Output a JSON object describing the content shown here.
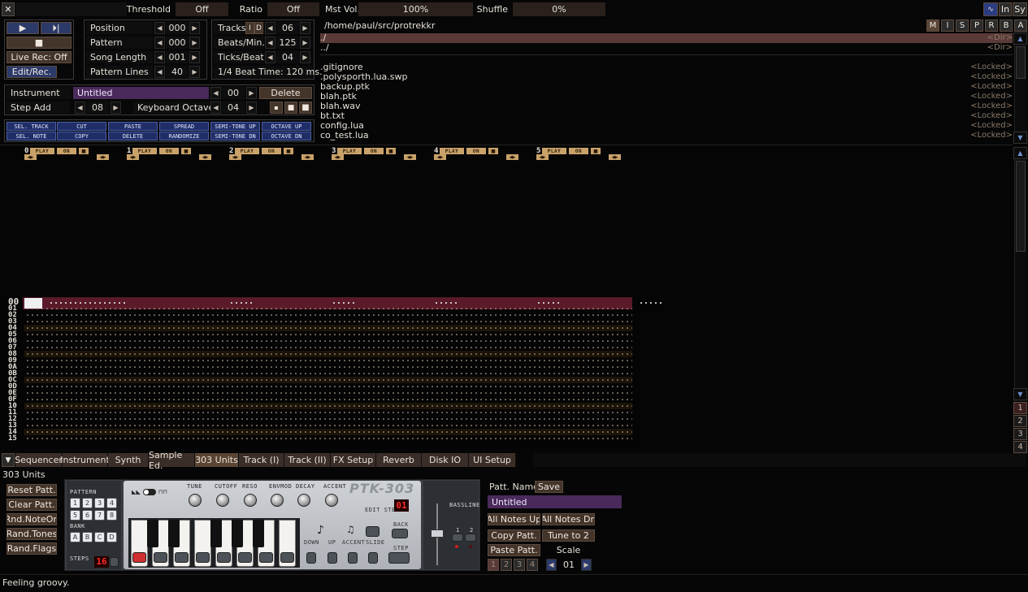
{
  "topbar": {
    "threshold_label": "Threshold",
    "threshold_value": "Off",
    "ratio_label": "Ratio",
    "ratio_value": "Off",
    "mst_vol_label": "Mst Vol.",
    "mst_vol_value": "100%",
    "shuffle_label": "Shuffle",
    "shuffle_value": "0%",
    "right_buttons": [
      "In",
      "Sy"
    ]
  },
  "transport": {
    "live_rec": "Live Rec: Off",
    "edit_rec": "Edit/Rec."
  },
  "song": {
    "position_label": "Position",
    "position_value": "000",
    "pattern_label": "Pattern",
    "pattern_value": "000",
    "song_length_label": "Song Length",
    "song_length_value": "001",
    "pattern_lines_label": "Pattern Lines",
    "pattern_lines_value": "40"
  },
  "tempo": {
    "tracks_label": "Tracks",
    "tracks_i": "I",
    "tracks_d": "D",
    "tracks_value": "06",
    "bpm_label": "Beats/Min.",
    "bpm_value": "125",
    "tpb_label": "Ticks/Beat",
    "tpb_value": "04",
    "beat_time": "1/4 Beat Time: 120 ms."
  },
  "instrument": {
    "label": "Instrument",
    "name": "Untitled",
    "number": "00",
    "delete": "Delete",
    "step_add_label": "Step Add",
    "step_add_value": "08",
    "kb_octave_label": "Keyboard Octave",
    "kb_octave_value": "04"
  },
  "fx_buttons": {
    "row1": [
      "SEL. TRACK",
      "CUT",
      "PASTE",
      "SPREAD",
      "SEMI-TONE UP",
      "OCTAVE UP"
    ],
    "row2": [
      "SEL. NOTE",
      "COPY",
      "DELETE",
      "RANDOMIZE",
      "SEMI-TONE DN",
      "OCTAVE DN"
    ]
  },
  "filebrowser": {
    "path": "/home/paul/src/protrekkr",
    "mode_buttons": [
      "M",
      "I",
      "S",
      "P",
      "R",
      "B",
      "A"
    ],
    "dirs": [
      {
        "name": "./",
        "tag": "<Dir>"
      },
      {
        "name": "../",
        "tag": "<Dir>"
      }
    ],
    "files": [
      {
        "name": ".gitignore",
        "tag": "<Locked>"
      },
      {
        "name": ".polysporth.lua.swp",
        "tag": "<Locked>"
      },
      {
        "name": "backup.ptk",
        "tag": "<Locked>"
      },
      {
        "name": "blah.ptk",
        "tag": "<Locked>"
      },
      {
        "name": "blah.wav",
        "tag": "<Locked>"
      },
      {
        "name": "bt.txt",
        "tag": "<Locked>"
      },
      {
        "name": "config.lua",
        "tag": "<Locked>"
      },
      {
        "name": "co_test.lua",
        "tag": "<Locked>"
      }
    ]
  },
  "tracks": [
    {
      "num": "0",
      "play": "PLAY",
      "on": "ON"
    },
    {
      "num": "1",
      "play": "PLAY",
      "on": "ON"
    },
    {
      "num": "2",
      "play": "PLAY",
      "on": "ON"
    },
    {
      "num": "3",
      "play": "PLAY",
      "on": "ON"
    },
    {
      "num": "4",
      "play": "PLAY",
      "on": "ON"
    },
    {
      "num": "5",
      "play": "PLAY",
      "on": "ON"
    }
  ],
  "pattern_rows": [
    "00",
    "01",
    "02",
    "03",
    "04",
    "05",
    "06",
    "07",
    "08",
    "09",
    "0A",
    "0B",
    "0C",
    "0D",
    "0E",
    "0F",
    "10",
    "11",
    "12",
    "13",
    "14",
    "15"
  ],
  "right_scroll_numbers": [
    "1",
    "2",
    "3",
    "4"
  ],
  "tabs": [
    "Sequencer",
    "Instrument",
    "Synth",
    "Sample Ed.",
    "303 Units",
    "Track (I)",
    "Track (II)",
    "FX Setup",
    "Reverb",
    "Disk IO",
    "UI Setup"
  ],
  "active_tab": "303 Units",
  "units303": {
    "title": "303 Units",
    "left_buttons": [
      "Reset Patt.",
      "Clear Patt.",
      "Rnd.NoteOn",
      "Rand.Tones",
      "Rand.Flags"
    ],
    "pattern_label": "PATTERN",
    "pattern_buttons": [
      "1",
      "2",
      "3",
      "4",
      "5",
      "6",
      "7",
      "8"
    ],
    "bank_label": "BANK",
    "bank_buttons": [
      "A",
      "B",
      "C",
      "D"
    ],
    "steps_label": "STEPS",
    "steps_value": "16",
    "knob_labels": [
      "TUNE",
      "CUTOFF",
      "RESO",
      "ENVMOD",
      "DECAY",
      "ACCENT"
    ],
    "logo": "PTK-303",
    "edit_step_label": "EDIT STEP",
    "edit_step_value": "01",
    "step_labels": [
      "DOWN",
      "UP",
      "ACCENT",
      "SLIDE"
    ],
    "back_label": "BACK",
    "step_label": "STEP",
    "bassline_label": "BASSLINE",
    "bassline_units": [
      "1",
      "2"
    ],
    "patt_name_label": "Patt. Name",
    "save_label": "Save",
    "patt_name_value": "Untitled",
    "all_notes_up": "All Notes Up",
    "all_notes_dn": "All Notes Dn",
    "copy_patt": "Copy Patt.",
    "tune_to_2": "Tune to 2",
    "paste_patt": "Paste Patt.",
    "scale_label": "Scale",
    "scale_value": "01",
    "slot_buttons": [
      "1",
      "2",
      "3",
      "4"
    ]
  },
  "status": "Feeling groovy."
}
